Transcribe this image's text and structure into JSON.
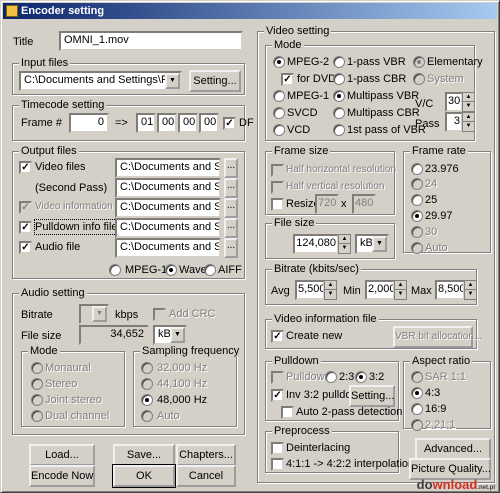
{
  "window": {
    "title": "Encoder setting"
  },
  "title_row": {
    "label": "Title",
    "value": "OMNI_1.mov"
  },
  "input_files": {
    "label": "Input files",
    "path": "C:\\Documents and Settings\\Ray Wallick\\",
    "setting_btn": "Setting..."
  },
  "timecode": {
    "label": "Timecode setting",
    "frame_label": "Frame #",
    "frame_value": "0",
    "arrow": "=>",
    "hh": "01",
    "mm": "00",
    "ss": "00",
    "ff": "00",
    "df_label": "DF"
  },
  "output": {
    "label": "Output files",
    "video_files": "Video files",
    "second_pass": "(Second Pass)",
    "video_info": "Video information file",
    "pulldown_info": "Pulldown info file",
    "audio_file": "Audio file",
    "path1": "C:\\Documents and Settings",
    "path2": "C:\\Documents and Settings",
    "path3": "C:\\Documents and Settings",
    "path4": "C:\\Documents and Settings",
    "path5": "C:\\Documents and Settings",
    "browse": "...",
    "fmt_mpeg1": "MPEG-1",
    "fmt_wave": "Wave",
    "fmt_aiff": "AIFF"
  },
  "audio": {
    "label": "Audio setting",
    "bitrate_label": "Bitrate",
    "kbps": "kbps",
    "add_crc": "Add CRC",
    "filesize_label": "File size",
    "filesize_value": "34,652",
    "filesize_unit": "kB",
    "mode_label": "Mode",
    "mode_mono": "Monaural",
    "mode_stereo": "Stereo",
    "mode_joint": "Joint stereo",
    "mode_dual": "Dual channel",
    "sf_label": "Sampling frequency",
    "sf_32": "32,000 Hz",
    "sf_44": "44,100 Hz",
    "sf_48": "48,000 Hz",
    "sf_auto": "Auto"
  },
  "bottom_buttons": {
    "load": "Load...",
    "save": "Save...",
    "chapters": "Chapters...",
    "encode_now": "Encode Now",
    "ok": "OK",
    "cancel": "Cancel"
  },
  "video": {
    "label": "Video setting",
    "mode_label": "Mode",
    "mpeg2": "MPEG-2",
    "for_dvd": "for DVD",
    "mpeg1": "MPEG-1",
    "svcd": "SVCD",
    "vcd": "VCD",
    "pass1_vbr": "1-pass VBR",
    "pass1_cbr": "1-pass CBR",
    "multi_vbr": "Multipass VBR",
    "multi_cbr": "Multipass CBR",
    "first_vbr": "1st pass of VBR",
    "elementary": "Elementary",
    "system": "System",
    "vc_label": "V/C",
    "vc_value": "30",
    "pass_label": "Pass",
    "pass_value": "3"
  },
  "frame_size": {
    "label": "Frame size",
    "half_h": "Half horizontal resolution",
    "half_v": "Half vertical resolution",
    "resize": "Resize",
    "w": "720",
    "x": "x",
    "h": "480"
  },
  "frame_rate": {
    "label": "Frame rate",
    "r1": "23.976",
    "r2": "24",
    "r3": "25",
    "r4": "29.97",
    "r5": "30",
    "r6": "Auto"
  },
  "file_size": {
    "label": "File size",
    "value": "124,080",
    "unit": "kB"
  },
  "bitrate": {
    "label": "Bitrate (kbits/sec)",
    "avg_label": "Avg",
    "avg": "5,500",
    "min_label": "Min",
    "min": "2,000",
    "max_label": "Max",
    "max": "8,500"
  },
  "video_info": {
    "label": "Video information file",
    "create_new": "Create new",
    "vbr_btn": "VBR bit allocation..."
  },
  "pulldown": {
    "label": "Pulldown",
    "pulldown": "Pulldown",
    "r23": "2:3",
    "r32": "3:2",
    "inv": "Inv 3:2 pulldown",
    "setting": "Setting...",
    "auto2": "Auto 2-pass detection"
  },
  "aspect": {
    "label": "Aspect ratio",
    "sar": "SAR 1:1",
    "a43": "4:3",
    "a169": "16:9",
    "a221": "2.21:1"
  },
  "preprocess": {
    "label": "Preprocess",
    "deinterlace": "Deinterlacing",
    "interp": "4:1:1 -> 4:2:2 interpolation"
  },
  "side_buttons": {
    "advanced": "Advanced...",
    "quality": "Picture Quality..."
  },
  "watermark": {
    "pre": "do",
    "mid": "wnload",
    "suffix": ".net.pl"
  }
}
